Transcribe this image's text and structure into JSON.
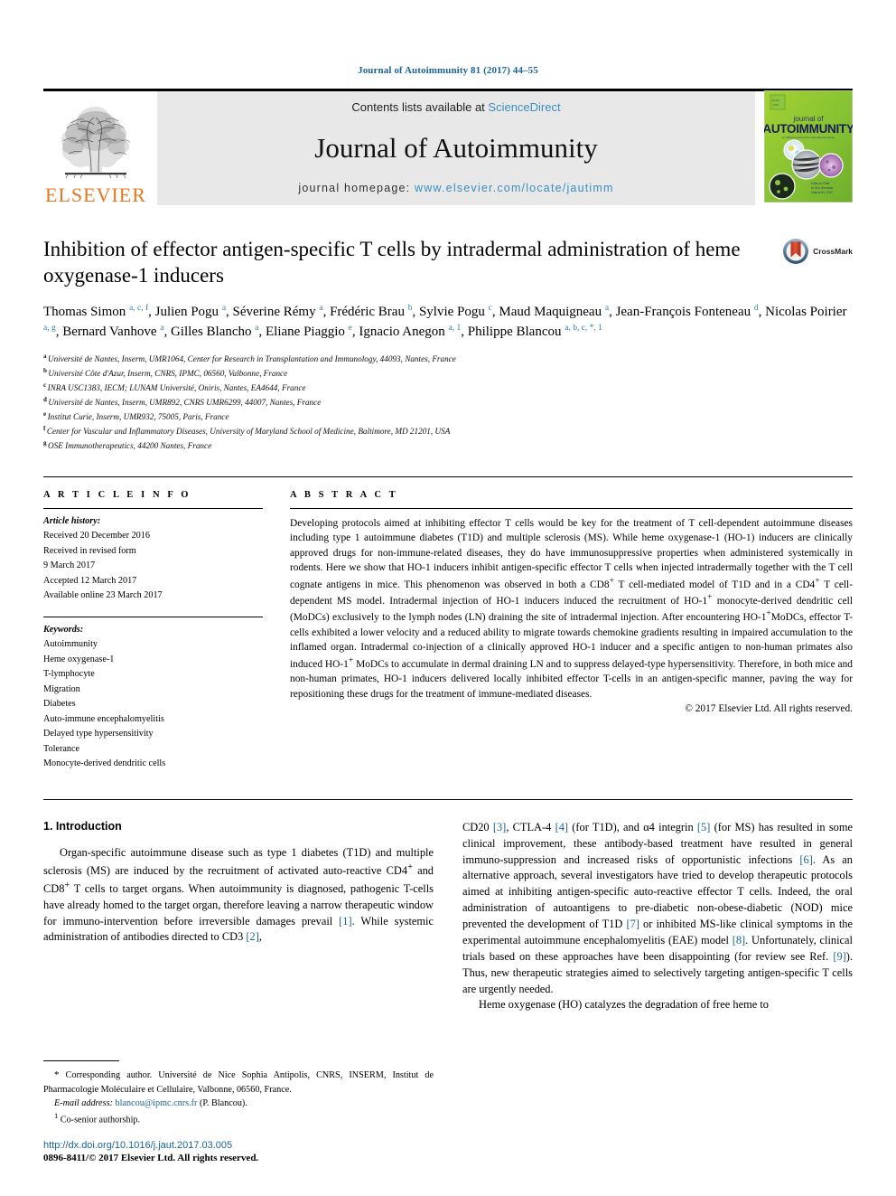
{
  "running_head": "Journal of Autoimmunity 81 (2017) 44–55",
  "masthead": {
    "publisher_logo_name": "ELSEVIER",
    "contents_prefix": "Contents lists available at ",
    "contents_link": "ScienceDirect",
    "journal_name": "Journal of Autoimmunity",
    "homepage_prefix": "journal homepage: ",
    "homepage_url": "www.elsevier.com/locate/jautimm",
    "cover": {
      "line1": "journal of",
      "line2": "AUTOIMMUNITY",
      "tagline": "an official journal of the international society"
    }
  },
  "article": {
    "title": "Inhibition of effector antigen-specific T cells by intradermal administration of heme oxygenase-1 inducers",
    "crossmark_label": "CrossMark",
    "authors_html": "Thomas Simon <sup>a, c, f</sup>, Julien Pogu <sup>a</sup>, Séverine Rémy <sup>a</sup>, Frédéric Brau <sup>b</sup>, Sylvie Pogu <sup>c</sup>, Maud Maquigneau <sup>a</sup>, Jean-François Fonteneau <sup>d</sup>, Nicolas Poirier <sup>a, g</sup>, Bernard Vanhove <sup>a</sup>, Gilles Blancho <sup>a</sup>, Eliane Piaggio <sup>e</sup>, Ignacio Anegon <sup>a, 1</sup>, Philippe Blancou <sup>a, b, c, *, 1</sup>",
    "affiliations": [
      {
        "marker": "a",
        "text": "Université de Nantes, Inserm, UMR1064, Center for Research in Transplantation and Immunology, 44093, Nantes, France"
      },
      {
        "marker": "b",
        "text": "Université Côte d'Azur, Inserm, CNRS, IPMC, 06560, Valbonne, France"
      },
      {
        "marker": "c",
        "text": "INRA USC1383, IECM; LUNAM Université, Oniris, Nantes, EA4644, France"
      },
      {
        "marker": "d",
        "text": "Université de Nantes, Inserm, UMR892, CNRS UMR6299, 44007, Nantes, France"
      },
      {
        "marker": "e",
        "text": "Institut Curie, Inserm, UMR932, 75005, Paris, France"
      },
      {
        "marker": "f",
        "text": "Center for Vascular and Inflammatory Diseases, University of Maryland School of Medicine, Baltimore, MD 21201, USA"
      },
      {
        "marker": "g",
        "text": "OSE Immunotherapeutics, 44200 Nantes, France"
      }
    ]
  },
  "article_info": {
    "heading": "A R T I C L E   I N F O",
    "history_label": "Article history:",
    "history": [
      "Received 20 December 2016",
      "Received in revised form",
      "9 March 2017",
      "Accepted 12 March 2017",
      "Available online 23 March 2017"
    ],
    "keywords_label": "Keywords:",
    "keywords": [
      "Autoimmunity",
      "Heme oxygenase-1",
      "T-lymphocyte",
      "Migration",
      "Diabetes",
      "Auto-immune encephalomyelitis",
      "Delayed type hypersensitivity",
      "Tolerance",
      "Monocyte-derived dendritic cells"
    ]
  },
  "abstract": {
    "heading": "A B S T R A C T",
    "text_html": "Developing protocols aimed at inhibiting effector T cells would be key for the treatment of T cell-dependent autoimmune diseases including type 1 autoimmune diabetes (T1D) and multiple sclerosis (MS). While heme oxygenase-1 (HO-1) inducers are clinically approved drugs for non-immune-related diseases, they do have immunosuppressive properties when administered systemically in rodents. Here we show that HO-1 inducers inhibit antigen-specific effector T cells when injected intradermally together with the T cell cognate antigens in mice. This phenomenon was observed in both a CD8<sup>+</sup> T cell-mediated model of T1D and in a CD4<sup>+</sup> T cell-dependent MS model. Intradermal injection of HO-1 inducers induced the recruitment of HO-1<sup>+</sup> monocyte-derived dendritic cell (MoDCs) exclusively to the lymph nodes (LN) draining the site of intradermal injection. After encountering HO-1<sup>+</sup>MoDCs, effector T-cells exhibited a lower velocity and a reduced ability to migrate towards chemokine gradients resulting in impaired accumulation to the inflamed organ. Intradermal co-injection of a clinically approved HO-1 inducer and a specific antigen to non-human primates also induced HO-1<sup>+</sup> MoDCs to accumulate in dermal draining LN and to suppress delayed-type hypersensitivity. Therefore, in both mice and non-human primates, HO-1 inducers delivered locally inhibited effector T-cells in an antigen-specific manner, paving the way for repositioning these drugs for the treatment of immune-mediated diseases.",
    "copyright": "© 2017 Elsevier Ltd. All rights reserved."
  },
  "body": {
    "section_number_title": "1.  Introduction",
    "left_paragraph_html": "Organ-specific autoimmune disease such as type 1 diabetes (T1D) and multiple sclerosis (MS) are induced by the recruitment of activated auto-reactive CD4<sup>+</sup> and CD8<sup>+</sup> T cells to target organs. When autoimmunity is diagnosed, pathogenic T-cells have already homed to the target organ, therefore leaving a narrow therapeutic window for immuno-intervention before irreversible damages prevail <span class=\"ref\">[1]</span>. While systemic administration of antibodies directed to CD3 <span class=\"ref\">[2]</span>,",
    "right_paragraph_1_html": "CD20 <span class=\"ref\">[3]</span>, CTLA-4 <span class=\"ref\">[4]</span> (for T1D), and α4 integrin <span class=\"ref\">[5]</span> (for MS) has resulted in some clinical improvement, these antibody-based treatment have resulted in general immuno-suppression and increased risks of opportunistic infections <span class=\"ref\">[6]</span>. As an alternative approach, several investigators have tried to develop therapeutic protocols aimed at inhibiting antigen-specific auto-reactive effector T cells. Indeed, the oral administration of autoantigens to pre-diabetic non-obese-diabetic (NOD) mice prevented the development of T1D <span class=\"ref\">[7]</span> or inhibited MS-like clinical symptoms in the experimental autoimmune encephalomyelitis (EAE) model <span class=\"ref\">[8]</span>. Unfortunately, clinical trials based on these approaches have been disappointing (for review see Ref. <span class=\"ref\">[9]</span>). Thus, new therapeutic strategies aimed to selectively targeting antigen-specific T cells are urgently needed.",
    "right_paragraph_2_html": "Heme oxygenase (HO) catalyzes the degradation of free heme to"
  },
  "footnotes": {
    "corresponding_html": "<span class=\"star\">*</span> Corresponding author. Université de Nice Sophia Antipolis, CNRS, INSERM, Institut de Pharmacologie Moléculaire et Cellulaire, Valbonne, 06560, France.",
    "email_label": "E-mail address:",
    "email": "blancou@ipmc.cnrs.fr",
    "email_suffix": "(P. Blancou).",
    "cosenior_html": "<sup>1</sup> Co-senior authorship.",
    "doi": "http://dx.doi.org/10.1016/j.jaut.2017.03.005",
    "issn_line": "0896-8411/© 2017 Elsevier Ltd. All rights reserved."
  },
  "colors": {
    "link_blue": "#1a6496",
    "ref_blue": "#1a6496",
    "elsevier_orange": "#E87722",
    "sciencedirect_blue": "#3a8fbf",
    "cover_green": "#8cc63f"
  }
}
